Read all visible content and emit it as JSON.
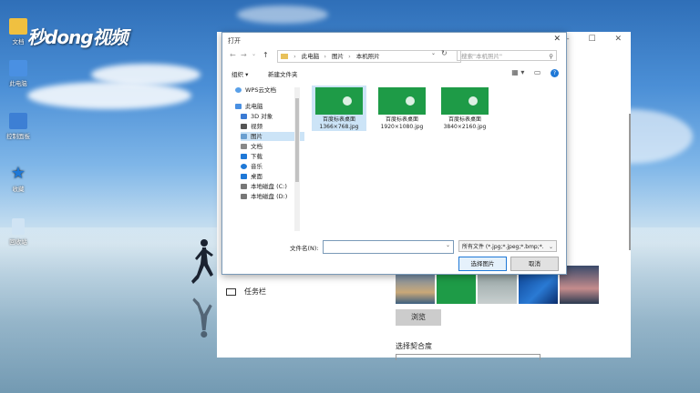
{
  "watermark": "秒dong视频",
  "desktop_icons": [
    {
      "label": "文档",
      "color": "#f0c040"
    },
    {
      "label": "此电脑",
      "color": "#4a90e2"
    },
    {
      "label": "控制面板",
      "color": "#3d7fd4"
    },
    {
      "label": "收藏",
      "color": "#1e78d7"
    },
    {
      "label": "回收站",
      "color": "#d0e4f4"
    }
  ],
  "settings": {
    "minimize": "—",
    "maximize": "☐",
    "close": "✕",
    "taskbar_label": "任务栏",
    "browse_label": "浏览",
    "fit_label": "选择契合度"
  },
  "dialog": {
    "title": "打开",
    "close": "✕",
    "nav": {
      "back": "←",
      "forward": "→",
      "recent": "⌄",
      "up": "↑"
    },
    "breadcrumbs": [
      "此电脑",
      "图片",
      "本机照片"
    ],
    "search_placeholder": "搜索\"本机照片\"",
    "toolbar": {
      "organize": "组织 ▾",
      "new_folder": "新建文件夹"
    },
    "nav_items": [
      {
        "label": "WPS云文档",
        "color": "#5aa0e8"
      },
      {
        "label": "此电脑",
        "color": "#4a90e2"
      },
      {
        "label": "3D 对象",
        "color": "#3b7bd4"
      },
      {
        "label": "视频",
        "color": "#555555"
      },
      {
        "label": "图片",
        "color": "#6a9fd0",
        "selected": true
      },
      {
        "label": "文档",
        "color": "#888888"
      },
      {
        "label": "下载",
        "color": "#1e78d7"
      },
      {
        "label": "音乐",
        "color": "#1e78d7"
      },
      {
        "label": "桌面",
        "color": "#1e78d7"
      },
      {
        "label": "本地磁盘 (C:)",
        "color": "#777777"
      },
      {
        "label": "本地磁盘 (D:)",
        "color": "#777777"
      }
    ],
    "files": [
      {
        "line1": "百度标表桌面",
        "line2": "1366×768.jpg",
        "selected": true
      },
      {
        "line1": "百度标表桌面",
        "line2": "1920×1080.jpg",
        "selected": false
      },
      {
        "line1": "百度标表桌面",
        "line2": "3840×2160.jpg",
        "selected": false
      }
    ],
    "filename_label": "文件名(N):",
    "filename_value": "",
    "filter_value": "所有文件 (*.jpg;*.jpeg;*.bmp;*.",
    "open_button": "选择图片",
    "cancel_button": "取消"
  }
}
